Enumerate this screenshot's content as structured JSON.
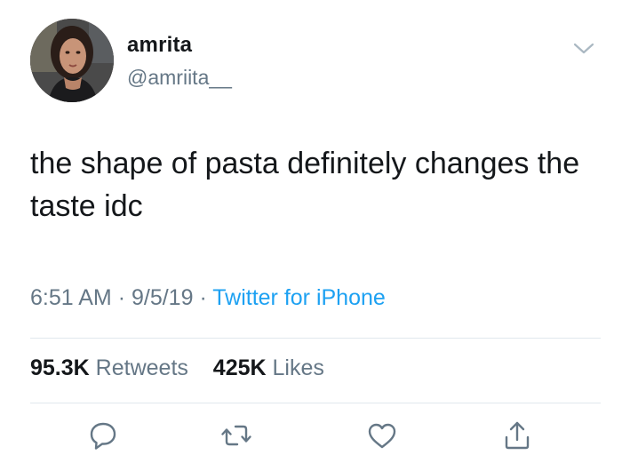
{
  "user": {
    "display_name": "amrita",
    "handle": "@amriita__",
    "avatar_icon": "profile-photo"
  },
  "tweet": {
    "text": "the shape of pasta definitely changes the taste idc",
    "time": "6:51 AM",
    "date": "9/5/19",
    "separator": "·",
    "source": "Twitter for iPhone"
  },
  "stats": {
    "retweets_count": "95.3K",
    "retweets_label": "Retweets",
    "likes_count": "425K",
    "likes_label": "Likes"
  },
  "actions": {
    "reply_icon": "reply-icon",
    "retweet_icon": "retweet-icon",
    "like_icon": "heart-icon",
    "share_icon": "share-icon"
  },
  "colors": {
    "text": "#14171a",
    "secondary": "#657786",
    "link": "#1da1f2",
    "divider": "#e1e8ed"
  }
}
